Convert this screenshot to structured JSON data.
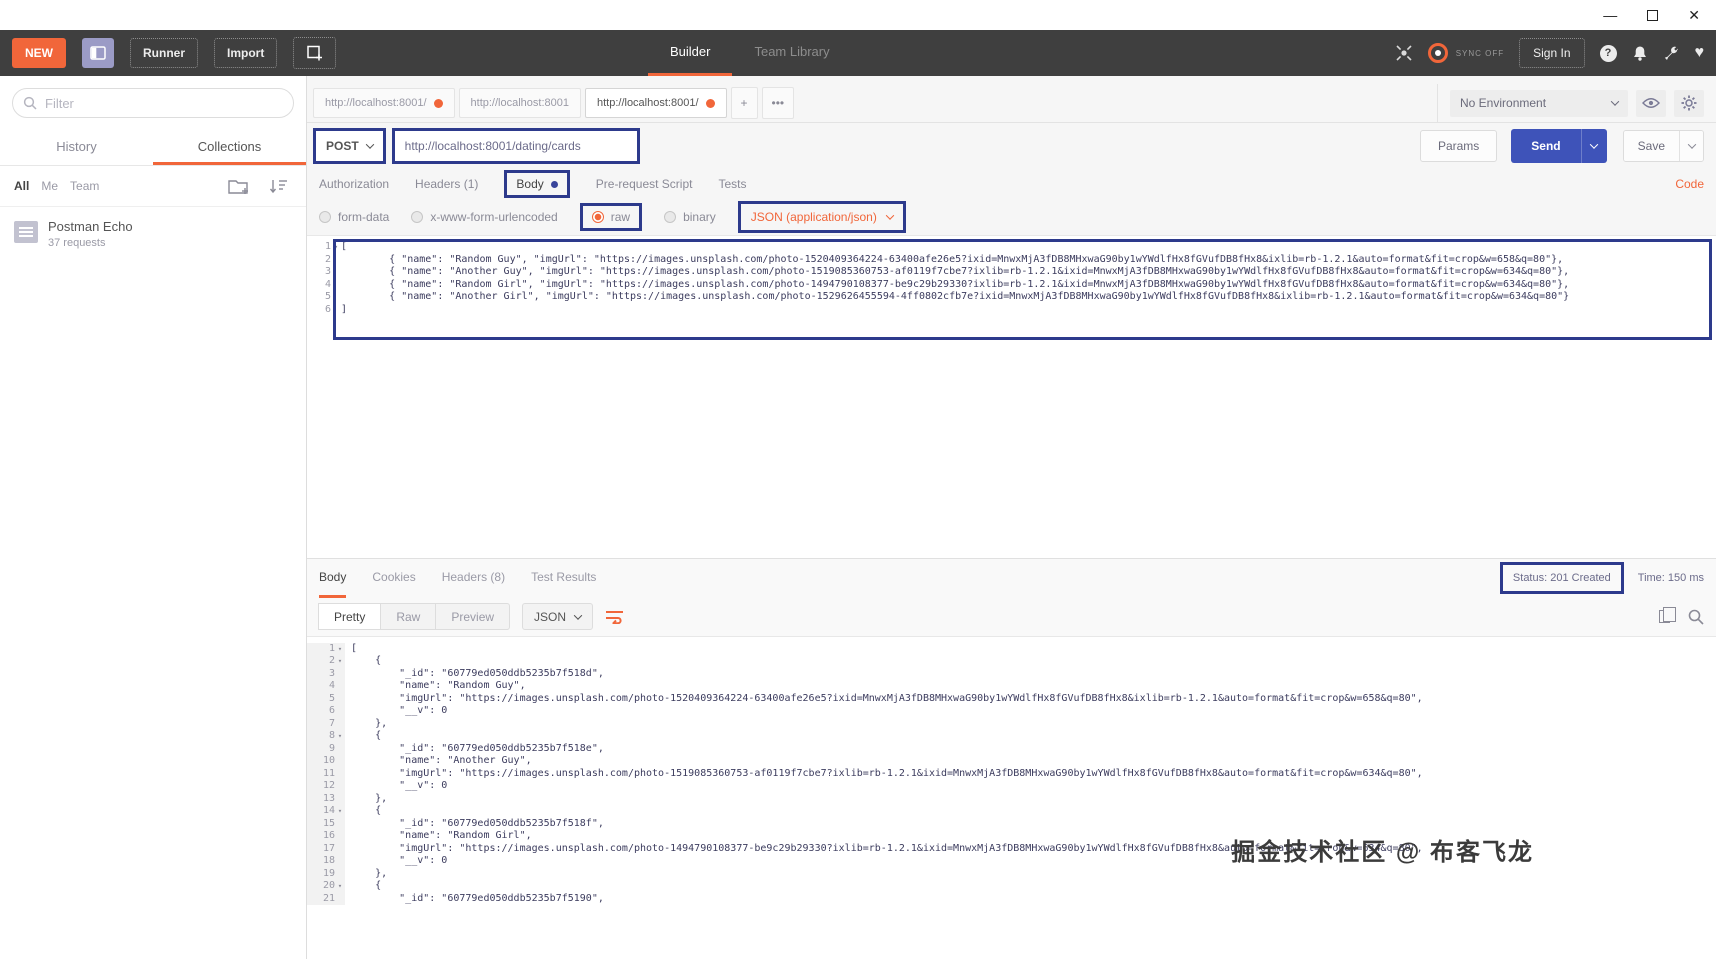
{
  "titlebar": {
    "minimize_glyph": "—",
    "close_glyph": "✕"
  },
  "header": {
    "new_label": "NEW",
    "runner_label": "Runner",
    "import_label": "Import",
    "nav_tabs": [
      {
        "label": "Builder",
        "active": true
      },
      {
        "label": "Team Library",
        "active": false
      }
    ],
    "sync_label": "SYNC OFF",
    "sign_in_label": "Sign In",
    "help_glyph": "?",
    "heart_glyph": "♥"
  },
  "sidebar": {
    "filter_placeholder": "Filter",
    "tabs": [
      {
        "label": "History",
        "active": false
      },
      {
        "label": "Collections",
        "active": true
      }
    ],
    "scopes": [
      {
        "label": "All",
        "active": true
      },
      {
        "label": "Me",
        "active": false
      },
      {
        "label": "Team",
        "active": false
      }
    ],
    "collections": [
      {
        "name": "Postman Echo",
        "meta": "37 requests"
      }
    ]
  },
  "tabstrip": {
    "tabs": [
      {
        "label": "http://localhost:8001/",
        "dirty": true,
        "active": false
      },
      {
        "label": "http://localhost:8001",
        "dirty": false,
        "active": false
      },
      {
        "label": "http://localhost:8001/",
        "dirty": true,
        "active": true
      }
    ],
    "add_label": "+",
    "more_label": "•••"
  },
  "environment": {
    "selected": "No Environment"
  },
  "request": {
    "method": "POST",
    "url": "http://localhost:8001/dating/cards",
    "params_label": "Params",
    "send_label": "Send",
    "save_label": "Save",
    "section_tabs": [
      {
        "label": "Authorization"
      },
      {
        "label": "Headers (1)"
      },
      {
        "label": "Body",
        "active": true,
        "dot": true,
        "annotated": true
      },
      {
        "label": "Pre-request Script"
      },
      {
        "label": "Tests"
      }
    ],
    "code_link": "Code",
    "body_modes": [
      {
        "label": "form-data"
      },
      {
        "label": "x-www-form-urlencoded"
      },
      {
        "label": "raw",
        "selected": true,
        "annotated": true
      },
      {
        "label": "binary"
      }
    ],
    "content_type": "JSON (application/json)",
    "editor_lines": [
      {
        "num": "1",
        "fold": true,
        "text": "["
      },
      {
        "num": "2",
        "text": "        { \"name\": \"Random Guy\", \"imgUrl\": \"https://images.unsplash.com/photo-1520409364224-63400afe26e5?ixid=MnwxMjA3fDB8MHxwaG90by1wYWdlfHx8fGVufDB8fHx8&ixlib=rb-1.2.1&auto=format&fit=crop&w=658&q=80\"},"
      },
      {
        "num": "3",
        "text": "        { \"name\": \"Another Guy\", \"imgUrl\": \"https://images.unsplash.com/photo-1519085360753-af0119f7cbe7?ixlib=rb-1.2.1&ixid=MnwxMjA3fDB8MHxwaG90by1wYWdlfHx8fGVufDB8fHx8&auto=format&fit=crop&w=634&q=80\"},"
      },
      {
        "num": "4",
        "text": "        { \"name\": \"Random Girl\", \"imgUrl\": \"https://images.unsplash.com/photo-1494790108377-be9c29b29330?ixlib=rb-1.2.1&ixid=MnwxMjA3fDB8MHxwaG90by1wYWdlfHx8fGVufDB8fHx8&auto=format&fit=crop&w=634&q=80\"},"
      },
      {
        "num": "5",
        "text": "        { \"name\": \"Another Girl\", \"imgUrl\": \"https://images.unsplash.com/photo-1529626455594-4ff0802cfb7e?ixid=MnwxMjA3fDB8MHxwaG90by1wYWdlfHx8fGVufDB8fHx8&ixlib=rb-1.2.1&auto=format&fit=crop&w=634&q=80\"}"
      },
      {
        "num": "6",
        "text": "]"
      }
    ]
  },
  "response": {
    "tabs": [
      {
        "label": "Body",
        "active": true
      },
      {
        "label": "Cookies"
      },
      {
        "label": "Headers (8)"
      },
      {
        "label": "Test Results"
      }
    ],
    "status": "Status: 201 Created",
    "time": "Time: 150 ms",
    "view_modes": [
      {
        "label": "Pretty",
        "active": true
      },
      {
        "label": "Raw"
      },
      {
        "label": "Preview"
      }
    ],
    "format": "JSON",
    "editor_lines": [
      {
        "num": "1",
        "fold": true,
        "text": "["
      },
      {
        "num": "2",
        "fold": true,
        "text": "    {"
      },
      {
        "num": "3",
        "text": "        \"_id\": \"60779ed050ddb5235b7f518d\","
      },
      {
        "num": "4",
        "text": "        \"name\": \"Random Guy\","
      },
      {
        "num": "5",
        "text": "        \"imgUrl\": \"https://images.unsplash.com/photo-1520409364224-63400afe26e5?ixid=MnwxMjA3fDB8MHxwaG90by1wYWdlfHx8fGVufDB8fHx8&ixlib=rb-1.2.1&auto=format&fit=crop&w=658&q=80\","
      },
      {
        "num": "6",
        "text": "        \"__v\": 0"
      },
      {
        "num": "7",
        "text": "    },"
      },
      {
        "num": "8",
        "fold": true,
        "text": "    {"
      },
      {
        "num": "9",
        "text": "        \"_id\": \"60779ed050ddb5235b7f518e\","
      },
      {
        "num": "10",
        "text": "        \"name\": \"Another Guy\","
      },
      {
        "num": "11",
        "text": "        \"imgUrl\": \"https://images.unsplash.com/photo-1519085360753-af0119f7cbe7?ixlib=rb-1.2.1&ixid=MnwxMjA3fDB8MHxwaG90by1wYWdlfHx8fGVufDB8fHx8&auto=format&fit=crop&w=634&q=80\","
      },
      {
        "num": "12",
        "text": "        \"__v\": 0"
      },
      {
        "num": "13",
        "text": "    },"
      },
      {
        "num": "14",
        "fold": true,
        "text": "    {"
      },
      {
        "num": "15",
        "text": "        \"_id\": \"60779ed050ddb5235b7f518f\","
      },
      {
        "num": "16",
        "text": "        \"name\": \"Random Girl\","
      },
      {
        "num": "17",
        "text": "        \"imgUrl\": \"https://images.unsplash.com/photo-1494790108377-be9c29b29330?ixlib=rb-1.2.1&ixid=MnwxMjA3fDB8MHxwaG90by1wYWdlfHx8fGVufDB8fHx8&auto=format&fit=crop&w=634&q=80\","
      },
      {
        "num": "18",
        "text": "        \"__v\": 0"
      },
      {
        "num": "19",
        "text": "    },"
      },
      {
        "num": "20",
        "fold": true,
        "text": "    {"
      },
      {
        "num": "21",
        "text": "        \"_id\": \"60779ed050ddb5235b7f5190\","
      }
    ]
  },
  "watermark": "掘金技术社区 @ 布客飞龙",
  "colors": {
    "accent_orange": "#f1663a",
    "send_blue": "#3e53b9",
    "annotation_blue": "#2d3a8c",
    "header_bg": "#3f3f3f"
  }
}
